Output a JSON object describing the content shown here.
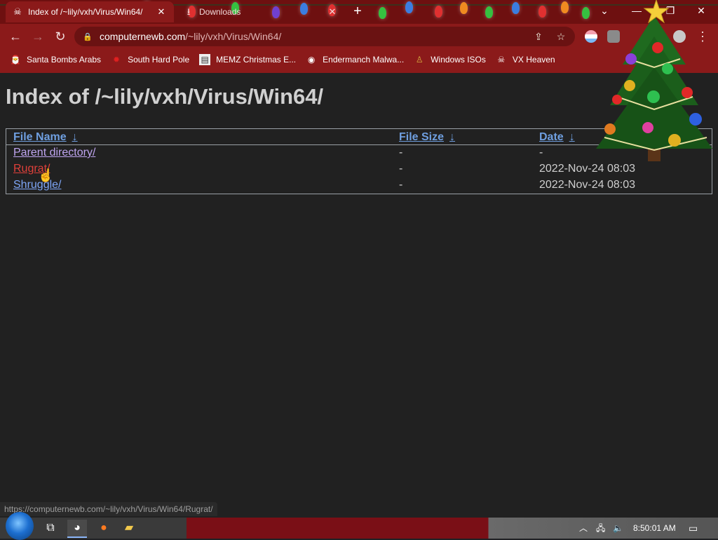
{
  "browser": {
    "tabs": [
      {
        "title": "Index of /~lily/vxh/Virus/Win64/",
        "active": true
      },
      {
        "title": "Downloads",
        "active": false
      }
    ],
    "url_host": "computernewb.com",
    "url_path": "/~lily/vxh/Virus/Win64/"
  },
  "bookmarks": [
    {
      "label": "Santa Bombs Arabs",
      "icon": "santa-icon"
    },
    {
      "label": "South Hard Pole",
      "icon": "star-icon"
    },
    {
      "label": "MEMZ Christmas E...",
      "icon": "page-icon"
    },
    {
      "label": "Endermanch Malwa...",
      "icon": "raccoon-icon"
    },
    {
      "label": "Windows ISOs",
      "icon": "figure-icon"
    },
    {
      "label": "VX Heaven",
      "icon": "skull-icon"
    }
  ],
  "page": {
    "heading": "Index of /~lily/vxh/Virus/Win64/",
    "columns": [
      {
        "label": "File Name",
        "arrow": "↓"
      },
      {
        "label": "File Size",
        "arrow": "↓"
      },
      {
        "label": "Date",
        "arrow": "↓"
      }
    ],
    "rows": [
      {
        "name": "Parent directory/",
        "size": "-",
        "date": "-"
      },
      {
        "name": "Rugrat/",
        "size": "-",
        "date": "2022-Nov-24 08:03"
      },
      {
        "name": "Shruggle/",
        "size": "-",
        "date": "2022-Nov-24 08:03"
      }
    ]
  },
  "status_url": "https://computernewb.com/~lily/vxh/Virus/Win64/Rugrat/",
  "taskbar": {
    "clock": "8:50:01 AM"
  },
  "colors": {
    "chrome_red": "#8b1a1a",
    "link_hover": "#e0403a",
    "link": "#7ea6f6",
    "header_link": "#6f9fe0"
  }
}
